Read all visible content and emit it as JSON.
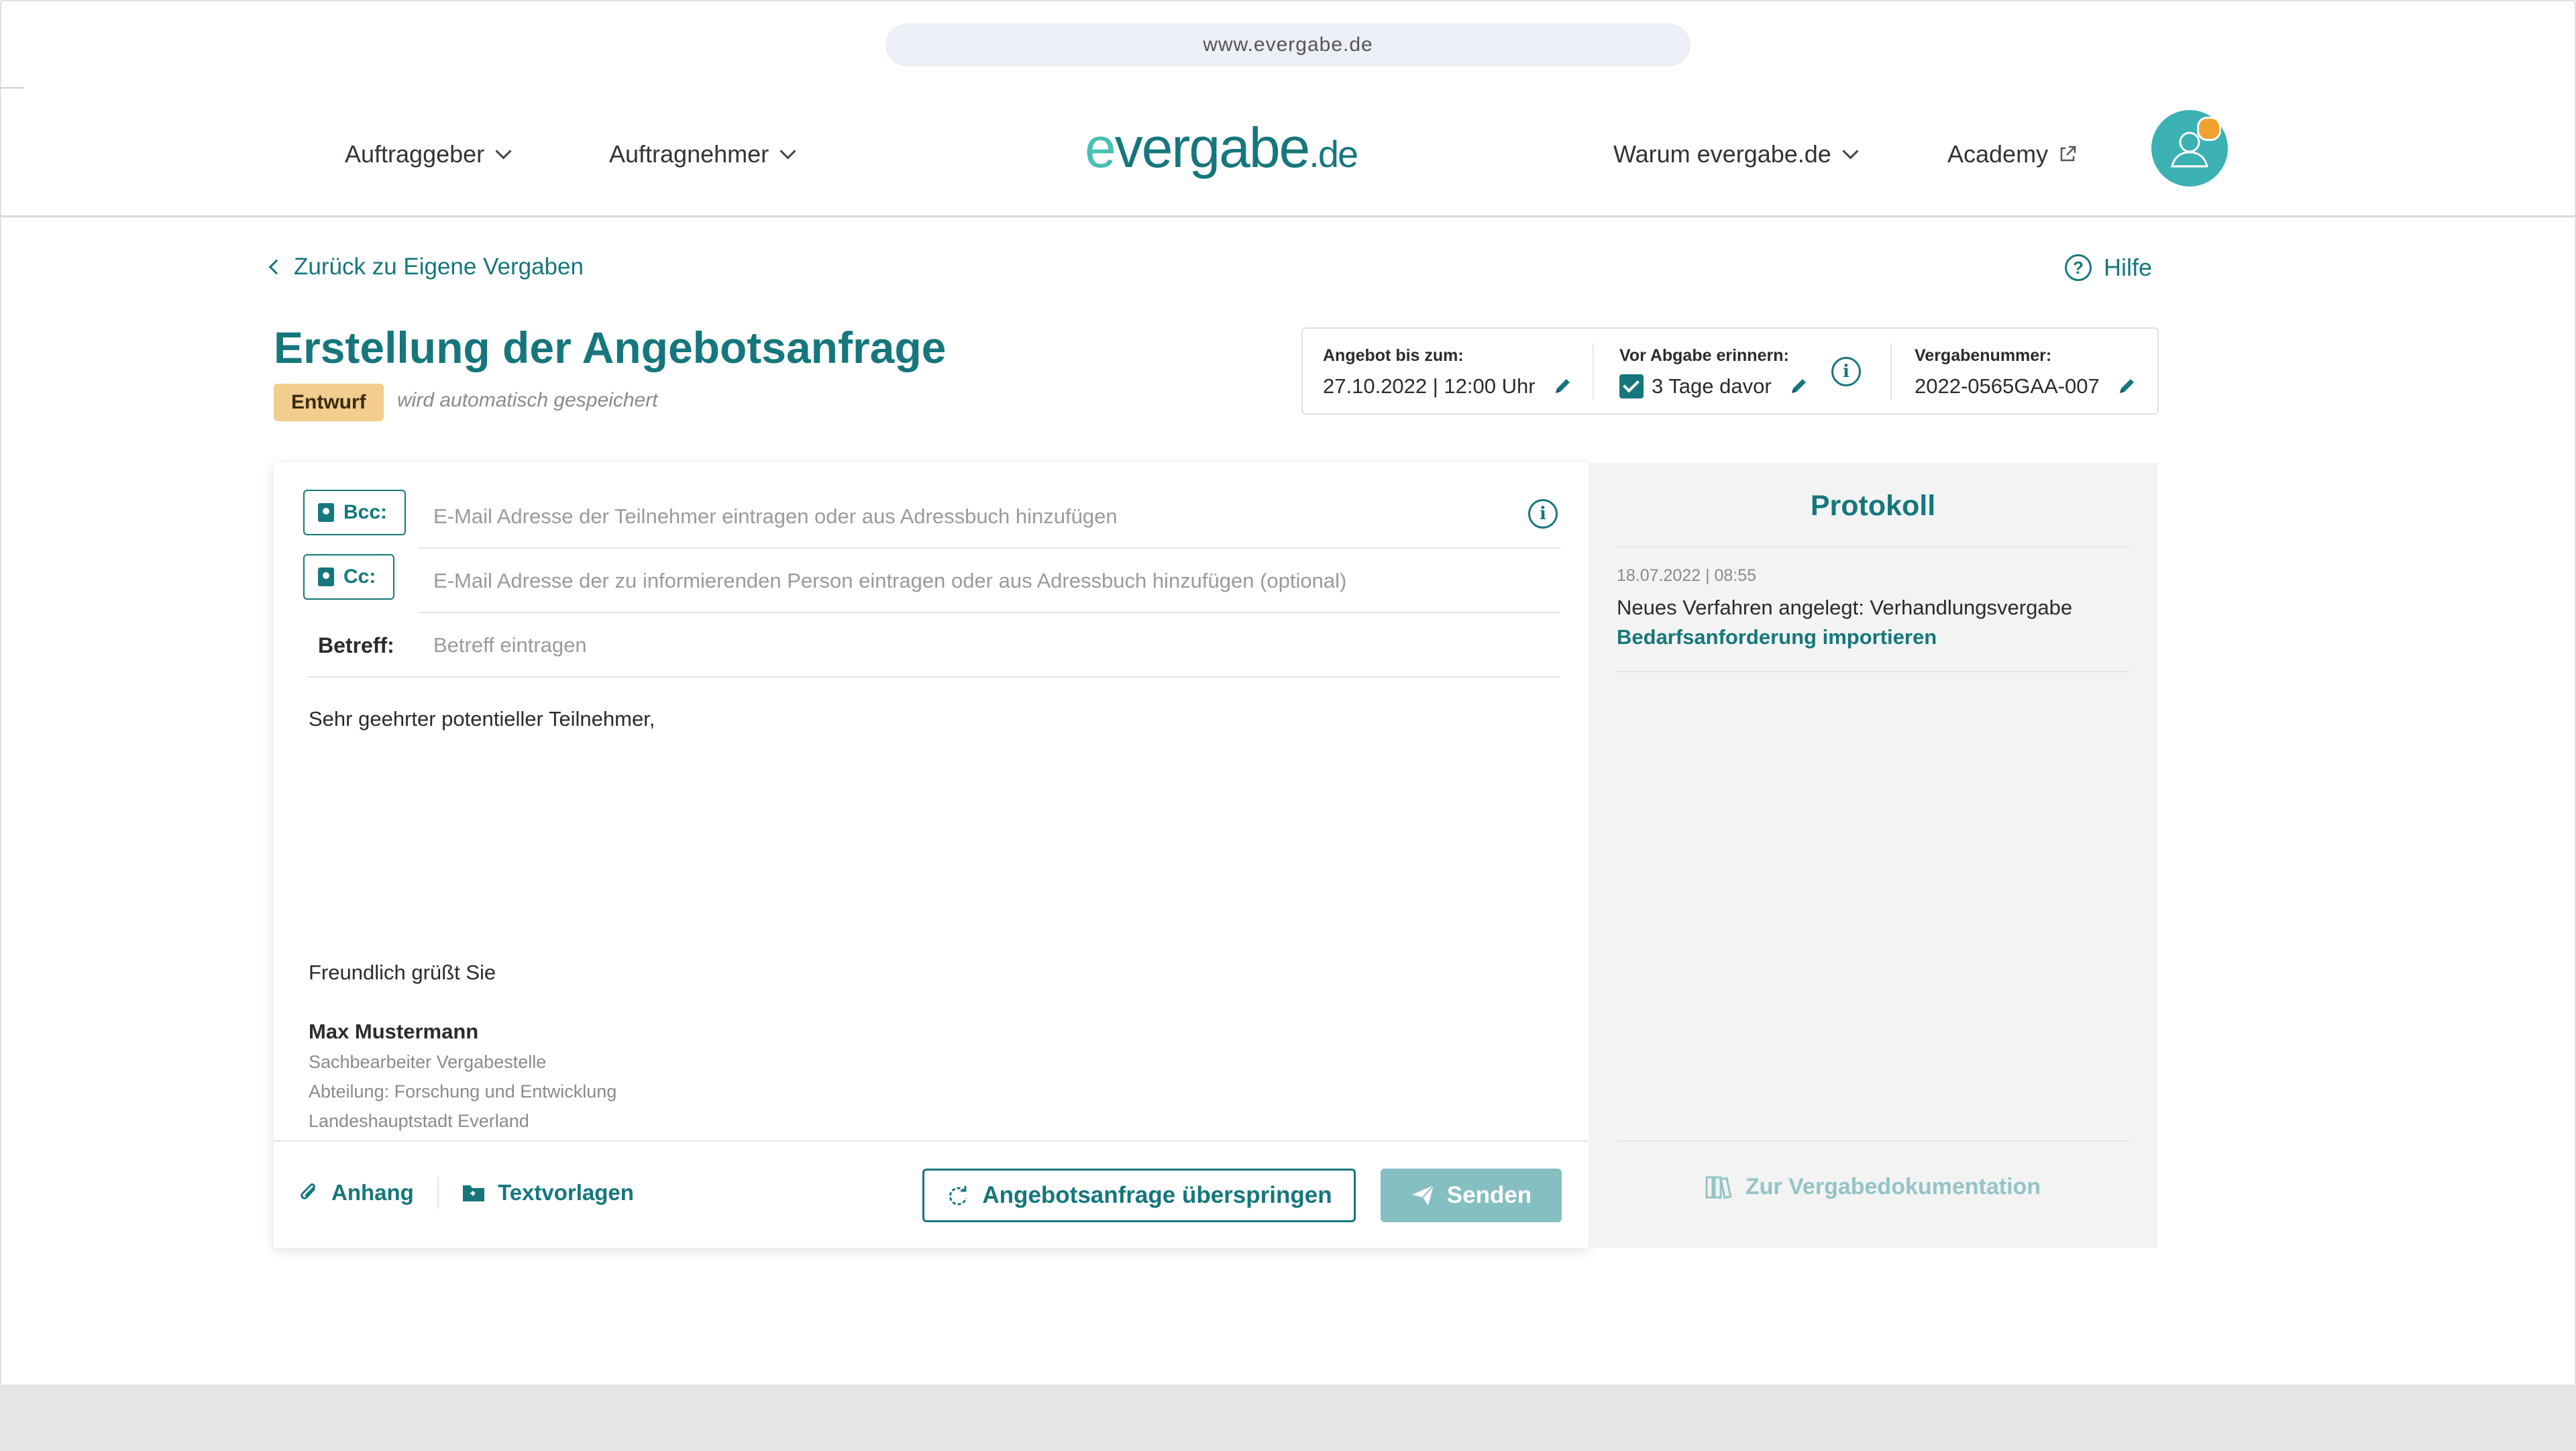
{
  "browser": {
    "url": "www.evergabe.de"
  },
  "nav": {
    "left_items": [
      {
        "label": "Auftraggeber"
      },
      {
        "label": "Auftragnehmer"
      }
    ],
    "logo": {
      "part_e": "e",
      "part_vergabe": "vergabe",
      "part_de": ".de"
    },
    "right_items": [
      {
        "label": "Warum evergabe.de"
      },
      {
        "label": "Academy"
      }
    ]
  },
  "page": {
    "back_link": "Zurück zu Eigene Vergaben",
    "help_label": "Hilfe",
    "title": "Erstellung der Angebotsanfrage",
    "status_badge": "Entwurf",
    "autosave_note": "wird automatisch gespeichert"
  },
  "infobox": {
    "offer_until_label": "Angebot bis zum:",
    "offer_until_value": "27.10.2022 | 12:00 Uhr",
    "reminder_label": "Vor Abgabe erinnern:",
    "reminder_value": "3 Tage davor",
    "reminder_checked": true,
    "award_number_label": "Vergabenummer:",
    "award_number_value": "2022-0565GAA-007"
  },
  "compose": {
    "bcc_label": "Bcc:",
    "bcc_placeholder": "E-Mail Adresse der Teilnehmer eintragen oder aus Adressbuch hinzufügen",
    "cc_label": "Cc:",
    "cc_placeholder": "E-Mail Adresse der zu informierenden Person eintragen oder aus Adressbuch hinzufügen (optional)",
    "subject_label": "Betreff:",
    "subject_placeholder": "Betreff eintragen",
    "greeting": "Sehr geehrter potentieller Teilnehmer,",
    "closing": "Freundlich grüßt Sie",
    "signature": {
      "name": "Max Mustermann",
      "role": "Sachbearbeiter Vergabestelle",
      "department": "Abteilung: Forschung und Entwicklung",
      "organization": "Landeshauptstadt Everland"
    },
    "attachment_label": "Anhang",
    "templates_label": "Textvorlagen",
    "skip_label": "Angebotsanfrage überspringen",
    "send_label": "Senden"
  },
  "protocol": {
    "title": "Protokoll",
    "entries": [
      {
        "timestamp": "18.07.2022 | 08:55",
        "text": "Neues Verfahren angelegt: Verhandlungsvergabe",
        "link": "Bedarfsanforderung importieren"
      }
    ],
    "docs_link": "Zur Vergabedokumentation"
  },
  "colors": {
    "brand": "#15777c",
    "brand_light": "#48c0b3",
    "badge": "#f2cd8d",
    "send_disabled": "#86bfc1",
    "avatar": "#3cb1b4",
    "avatar_dot": "#f2a22c"
  },
  "icons": {
    "nav_dropdown": "chevron-down-icon",
    "academy": "external-link-icon",
    "back": "chevron-left-icon",
    "help": "question-circle-icon",
    "edit": "pencil-icon",
    "info": "info-circle-icon",
    "address_book": "address-book-icon",
    "attachment": "paperclip-icon",
    "templates": "folder-icon",
    "skip": "rotate-arrows-icon",
    "send": "paper-plane-icon",
    "docs": "binders-icon"
  }
}
